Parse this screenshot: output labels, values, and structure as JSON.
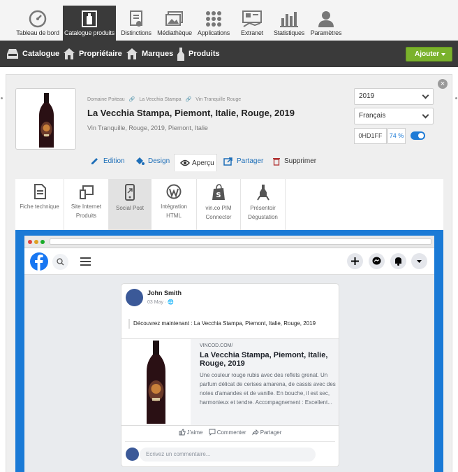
{
  "topnav": {
    "items": [
      {
        "label": "Tableau de bord",
        "icon": "dashboard-gauge-icon"
      },
      {
        "label": "Catalogue produits",
        "icon": "wine-catalog-icon"
      },
      {
        "label": "Distinctions",
        "icon": "medal-certificate-icon"
      },
      {
        "label": "Médiathèque",
        "icon": "images-icon"
      },
      {
        "label": "Applications",
        "icon": "grid-dots-icon"
      },
      {
        "label": "Extranet",
        "icon": "extranet-icon"
      },
      {
        "label": "Statistiques",
        "icon": "bar-chart-icon"
      },
      {
        "label": "Paramètres",
        "icon": "user-settings-icon"
      }
    ],
    "active_index": 1
  },
  "subnav": {
    "items": [
      {
        "label": "Catalogue",
        "icon": "inbox-tray-icon"
      },
      {
        "label": "Propriétaire",
        "icon": "house-icon"
      },
      {
        "label": "Marques",
        "icon": "house-icon"
      },
      {
        "label": "Produits",
        "icon": "bottle-icon"
      }
    ],
    "add_label": "Ajouter"
  },
  "product": {
    "breadcrumb": [
      "Domaine Poiteau",
      "La Vecchia Stampa",
      "Vin Tranquille Rouge"
    ],
    "title": "La Vecchia Stampa, Piemont, Italie, Rouge, 2019",
    "subtitle": "Vin Tranquille, Rouge, 2019, Piemont, Italie",
    "vintage": "2019",
    "language": "Français",
    "code": "0HD1FF",
    "completion": "74 %"
  },
  "tabs": [
    {
      "label": "Edition",
      "icon": "pencil-icon"
    },
    {
      "label": "Design",
      "icon": "paint-bucket-icon"
    },
    {
      "label": "Aperçu",
      "icon": "eye-icon"
    },
    {
      "label": "Partager",
      "icon": "share-icon"
    },
    {
      "label": "Supprimer",
      "icon": "trash-icon"
    }
  ],
  "channels": [
    {
      "line1": "Fiche technique",
      "line2": "",
      "icon": "document-icon"
    },
    {
      "line1": "Site Internet",
      "line2": "Produits",
      "icon": "devices-icon"
    },
    {
      "line1": "Social Post",
      "line2": "",
      "icon": "phone-share-icon"
    },
    {
      "line1": "Intégration",
      "line2": "HTML",
      "icon": "wordpress-icon"
    },
    {
      "line1": "vin.co PIM",
      "line2": "Connector",
      "icon": "shopify-bag-icon"
    },
    {
      "line1": "Présentoir",
      "line2": "Dégustation",
      "icon": "tasting-stand-icon"
    }
  ],
  "preview": {
    "author": "John Smith",
    "date": "03 May",
    "post_text": "Découvrez maintenant : La Vecchia Stampa, Piemont, Italie, Rouge, 2019",
    "link_domain": "VINCOD.COM/",
    "link_title": "La Vecchia Stampa, Piemont, Italie, Rouge, 2019",
    "link_description": "Une couleur rouge rubis avec des reflets grenat. Un parfum délicat de cerises amarena, de cassis avec des notes d'amandes et de vanille. En bouche, il est sec, harmonieux et tendre. Accompagnement : Excellent...",
    "like_label": "J'aime",
    "comment_label": "Commenter",
    "share_label": "Partager",
    "comment_placeholder": "Ecrivez un commentaire..."
  },
  "colors": {
    "accent_blue": "#1e7bd6",
    "add_green": "#7ab22c",
    "dark_bar": "#3a3a3a",
    "facebook_blue": "#1877f2"
  }
}
